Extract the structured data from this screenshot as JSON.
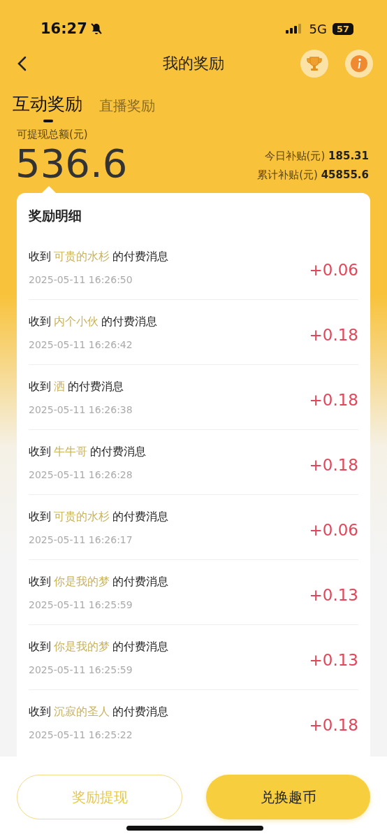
{
  "status_bar": {
    "time": "16:27",
    "network": "5G",
    "battery": "57"
  },
  "nav": {
    "title": "我的奖励"
  },
  "tabs": [
    {
      "label": "互动奖励",
      "selected": true
    },
    {
      "label": "直播奖励",
      "selected": false
    }
  ],
  "summary": {
    "label": "可提现总额(元)",
    "amount": "536.6",
    "stats": [
      {
        "label": "今日补贴(元)",
        "value": "185.31"
      },
      {
        "label": "累计补贴(元)",
        "value": "45855.6"
      }
    ]
  },
  "details": {
    "title": "奖励明细",
    "rows": [
      {
        "prefix": "收到",
        "name": "可贵的水杉",
        "suffix": "的付费消息",
        "time": "2025-05-11 16:26:50",
        "amount": "+0.06"
      },
      {
        "prefix": "收到",
        "name": "内个小伙",
        "suffix": "的付费消息",
        "time": "2025-05-11 16:26:42",
        "amount": "+0.18"
      },
      {
        "prefix": "收到",
        "name": "洒",
        "suffix": "的付费消息",
        "time": "2025-05-11 16:26:38",
        "amount": "+0.18"
      },
      {
        "prefix": "收到",
        "name": "牛牛哥",
        "suffix": "的付费消息",
        "time": "2025-05-11 16:26:28",
        "amount": "+0.18"
      },
      {
        "prefix": "收到",
        "name": "可贵的水杉",
        "suffix": "的付费消息",
        "time": "2025-05-11 16:26:17",
        "amount": "+0.06"
      },
      {
        "prefix": "收到",
        "name": "你是我的梦",
        "suffix": "的付费消息",
        "time": "2025-05-11 16:25:59",
        "amount": "+0.13"
      },
      {
        "prefix": "收到",
        "name": "你是我的梦",
        "suffix": "的付费消息",
        "time": "2025-05-11 16:25:59",
        "amount": "+0.13"
      },
      {
        "prefix": "收到",
        "name": "沉寂的圣人",
        "suffix": "的付费消息",
        "time": "2025-05-11 16:25:22",
        "amount": "+0.18"
      }
    ]
  },
  "buttons": [
    {
      "label": "奖励提现",
      "kind": "outline"
    },
    {
      "label": "兑换趣币",
      "kind": "filled"
    }
  ]
}
